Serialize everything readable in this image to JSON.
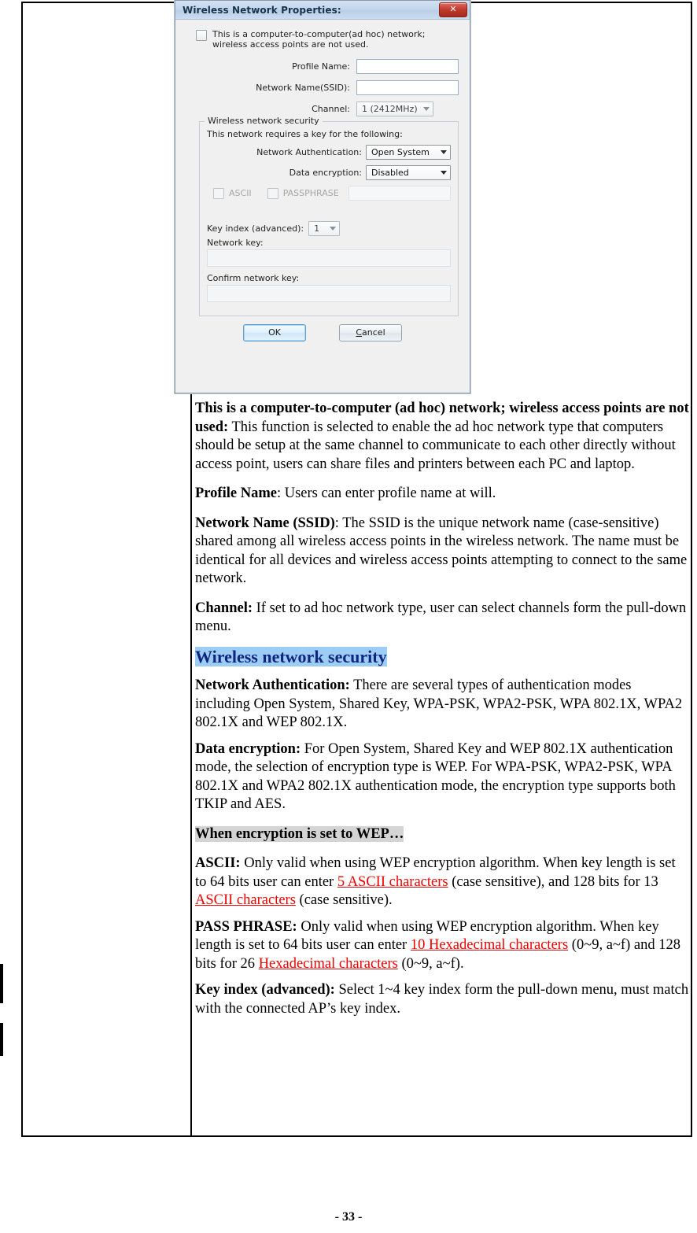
{
  "dialog": {
    "title": "Wireless Network Properties:",
    "close_label": "✕",
    "adhoc_checkbox_label": "This is a computer-to-computer(ad hoc) network; wireless access points are not used.",
    "profile_name_label": "Profile Name:",
    "profile_name_value": "",
    "ssid_label": "Network Name(SSID):",
    "ssid_value": "",
    "channel_label": "Channel:",
    "channel_value": "1  (2412MHz)",
    "security": {
      "legend": "Wireless network security",
      "requires_key_text": "This network requires a key for the following:",
      "network_auth_label": "Network Authentication:",
      "network_auth_value": "Open System",
      "data_encryption_label": "Data encryption:",
      "data_encryption_value": "Disabled",
      "ascii_label": "ASCII",
      "passphrase_label": "PASSPHRASE",
      "pass_value": "",
      "key_index_label": "Key index (advanced):",
      "key_index_value": "1",
      "network_key_label": "Network key:",
      "network_key_value": "",
      "confirm_key_label": "Confirm network key:",
      "confirm_key_value": ""
    },
    "ok_label": "OK",
    "cancel_label_prefix": "C",
    "cancel_label_rest": "ancel"
  },
  "body": {
    "p_adhoc_bold": "This is a computer-to-computer (ad hoc) network; wireless access points are not used:",
    "p_adhoc_rest": " This function is selected to enable the ad hoc network type that computers should be setup at the same channel to communicate to each other directly without access point, users can share files and printers between each PC and laptop.",
    "p_profile_bold": "Profile Name",
    "p_profile_rest": ": Users can enter profile name at will.",
    "p_ssid_bold": "Network Name (SSID)",
    "p_ssid_rest": ": The SSID is the unique network name (case-sensitive) shared among all wireless access points in the wireless network. The name must be identical for all devices and wireless access points attempting to connect to the same network.",
    "p_channel_bold": "Channel:",
    "p_channel_rest": " If set to ad hoc network type, user can select channels form the pull-down menu.",
    "heading_security": "Wireless network security",
    "p_auth_bold": "Network Authentication:",
    "p_auth_rest": " There are several types of authentication modes including Open System, Shared Key, WPA-PSK, WPA2-PSK, WPA 802.1X, WPA2 802.1X and WEP 802.1X.",
    "p_enc_bold": "Data encryption:",
    "p_enc_rest": " For Open System, Shared Key and WEP 802.1X authentication mode, the selection of encryption type is WEP. For WPA-PSK, WPA2-PSK, WPA 802.1X and WPA2 802.1X authentication mode, the encryption type supports both TKIP and AES.",
    "heading_wep": "When encryption is set to WEP…",
    "p_ascii_bold": "ASCII:",
    "p_ascii_part1": " Only valid when using WEP encryption algorithm. When key length is set to 64 bits user can enter ",
    "p_ascii_link1": "5 ASCII characters",
    "p_ascii_part2": " (case sensitive), and 128 bits for 13",
    "p_ascii_link2": " ASCII characters",
    "p_ascii_part3": " (case sensitive).",
    "p_pass_bold": "PASS PHRASE:",
    "p_pass_part1": " Only valid when using WEP encryption algorithm. When key length is set to 64 bits user can enter ",
    "p_pass_link1": "10 Hexadecimal characters",
    "p_pass_part2": " (0~9, a~f) and 128 bits for 26 ",
    "p_pass_link2": "Hexadecimal characters",
    "p_pass_part3": " (0~9, a~f).",
    "p_keyindex_bold": "Key index (advanced):",
    "p_keyindex_rest": " Select 1~4 key index form the pull-down menu, must match with the connected AP’s key index."
  },
  "footer": {
    "page_number": "- 33 -"
  }
}
